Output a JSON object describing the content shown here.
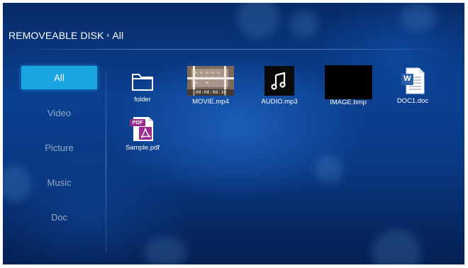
{
  "breadcrumb": {
    "location": "REMOVEABLE DISK",
    "separator": "›",
    "current": "All"
  },
  "sidebar": {
    "items": [
      {
        "label": "All",
        "active": true
      },
      {
        "label": "Video",
        "active": false
      },
      {
        "label": "Picture",
        "active": false
      },
      {
        "label": "Music",
        "active": false
      },
      {
        "label": "Doc",
        "active": false
      }
    ]
  },
  "files": [
    {
      "name": "folder",
      "icon": "folder-icon"
    },
    {
      "name": "MOVIE.mp4",
      "icon": "video-thumbnail",
      "overlay": "00:00:08:16"
    },
    {
      "name": "AUDIO.mp3",
      "icon": "music-note-icon"
    },
    {
      "name": "IMAGE.bmp",
      "icon": "image-thumbnail"
    },
    {
      "name": "DOC1.doc",
      "icon": "word-document-icon",
      "badge": "W"
    },
    {
      "name": "Sample.pdf",
      "icon": "pdf-document-icon",
      "badge": "PDF"
    }
  ],
  "colors": {
    "accent": "#19a6e0",
    "background": "#0a3a85"
  }
}
